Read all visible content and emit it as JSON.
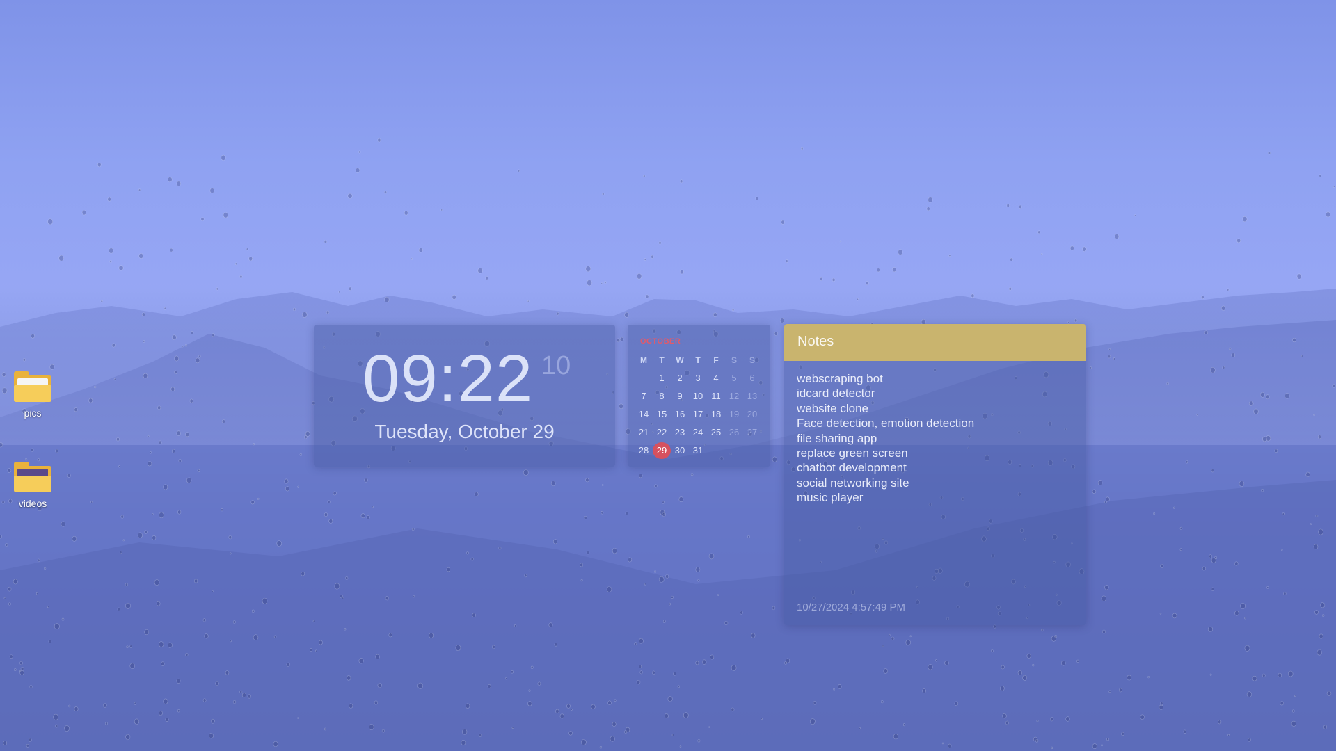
{
  "desktop": {
    "icons": [
      {
        "label": "pics",
        "icon": "folder-icon"
      },
      {
        "label": "videos",
        "icon": "folder-icon"
      }
    ]
  },
  "clock": {
    "time": "09:22",
    "seconds": "10",
    "date": "Tuesday, October 29"
  },
  "calendar": {
    "month": "OCTOBER",
    "weekdays": [
      "M",
      "T",
      "W",
      "T",
      "F",
      "S",
      "S"
    ],
    "weeks": [
      [
        "",
        "1",
        "2",
        "3",
        "4",
        "5",
        "6"
      ],
      [
        "7",
        "8",
        "9",
        "10",
        "11",
        "12",
        "13"
      ],
      [
        "14",
        "15",
        "16",
        "17",
        "18",
        "19",
        "20"
      ],
      [
        "21",
        "22",
        "23",
        "24",
        "25",
        "26",
        "27"
      ],
      [
        "28",
        "29",
        "30",
        "31",
        "",
        "",
        ""
      ]
    ],
    "today": "29",
    "today_color": "#d6515f",
    "month_color": "#e25a6a"
  },
  "notes": {
    "title": "Notes",
    "header_color": "#c9b46e",
    "items": [
      "webscraping bot",
      "idcard detector",
      "website clone",
      "Face detection, emotion detection",
      "file sharing app",
      "replace green screen",
      "chatbot development",
      "social networking site",
      "music player"
    ],
    "timestamp": "10/27/2024 4:57:49 PM"
  }
}
